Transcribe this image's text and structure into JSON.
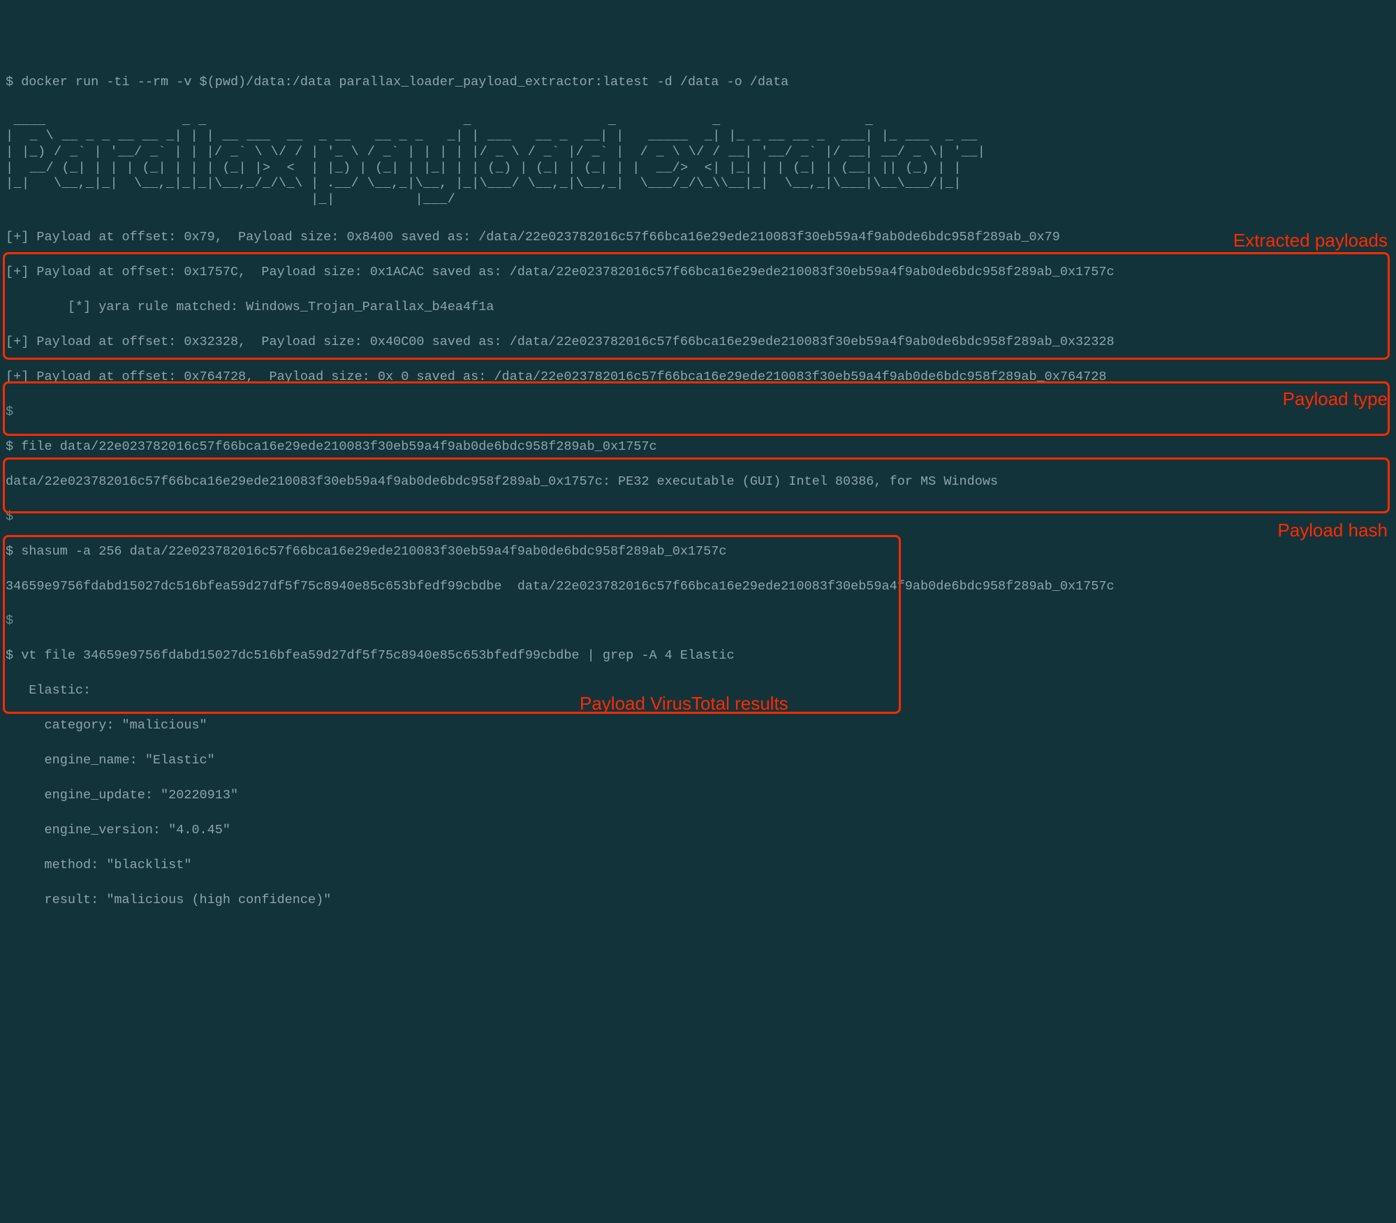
{
  "colors": {
    "bg": "#13333a",
    "fg": "#8ba6ab",
    "annotate": "#ff2a00"
  },
  "cmd_docker": "$ docker run -ti --rm -v $(pwd)/data:/data parallax_loader_payload_extractor:latest -d /data -o /data",
  "ascii_banner": " ____                 _ _                                _                 _            _                  _\n|  _ \\ __ _ _ __ __ _| | | __ ___  __  _ __   __ _ _   _| | ___   __ _  __| |   _____  _| |_ _ __ __ _  ___| |_ ___  _ __\n| |_) / _` | '__/ _` | | |/ _` \\ \\/ / | '_ \\ / _` | | | | |/ _ \\ / _` |/ _` |  / _ \\ \\/ / __| '__/ _` |/ __| __/ _ \\| '__|\n|  __/ (_| | | | (_| | | | (_| |>  <  | |_) | (_| | |_| | | (_) | (_| | (_| | |  __/>  <| |_| | | (_| | (__| || (_) | |\n|_|   \\__,_|_|  \\__,_|_|_|\\__,_/_/\\_\\ | .__/ \\__,_|\\__, |_|\\___/ \\__,_|\\__,_|  \\___/_/\\_\\\\__|_|  \\__,_|\\___|\\__\\___/|_|\n                                      |_|          |___/",
  "extracted": {
    "lines": [
      "[+] Payload at offset: 0x79,  Payload size: 0x8400 saved as: /data/22e023782016c57f66bca16e29ede210083f30eb59a4f9ab0de6bdc958f289ab_0x79",
      "[+] Payload at offset: 0x1757C,  Payload size: 0x1ACAC saved as: /data/22e023782016c57f66bca16e29ede210083f30eb59a4f9ab0de6bdc958f289ab_0x1757c",
      "        [*] yara rule matched: Windows_Trojan_Parallax_b4ea4f1a",
      "[+] Payload at offset: 0x32328,  Payload size: 0x40C00 saved as: /data/22e023782016c57f66bca16e29ede210083f30eb59a4f9ab0de6bdc958f289ab_0x32328",
      "[+] Payload at offset: 0x764728,  Payload size: 0x 0 saved as: /data/22e023782016c57f66bca16e29ede210083f30eb59a4f9ab0de6bdc958f289ab_0x764728"
    ]
  },
  "file_cmd": "$ file data/22e023782016c57f66bca16e29ede210083f30eb59a4f9ab0de6bdc958f289ab_0x1757c",
  "file_out": "data/22e023782016c57f66bca16e29ede210083f30eb59a4f9ab0de6bdc958f289ab_0x1757c: PE32 executable (GUI) Intel 80386, for MS Windows",
  "sha_cmd": "$ shasum -a 256 data/22e023782016c57f66bca16e29ede210083f30eb59a4f9ab0de6bdc958f289ab_0x1757c",
  "sha_out": "34659e9756fdabd15027dc516bfea59d27df5f75c8940e85c653bfedf99cbdbe  data/22e023782016c57f66bca16e29ede210083f30eb59a4f9ab0de6bdc958f289ab_0x1757c",
  "vt_cmd": "$ vt file 34659e9756fdabd15027dc516bfea59d27df5f75c8940e85c653bfedf99cbdbe | grep -A 4 Elastic",
  "vt_out": {
    "header": "   Elastic:",
    "category": "     category: \"malicious\"",
    "engine_name": "     engine_name: \"Elastic\"",
    "engine_update": "     engine_update: \"20220913\"",
    "engine_version": "     engine_version: \"4.0.45\"",
    "method": "     method: \"blacklist\"",
    "result": "     result: \"malicious (high confidence)\""
  },
  "labels": {
    "extracted": "Extracted payloads",
    "type": "Payload type",
    "hash": "Payload hash",
    "vt": "Payload VirusTotal results"
  },
  "prompt_bare": "$"
}
